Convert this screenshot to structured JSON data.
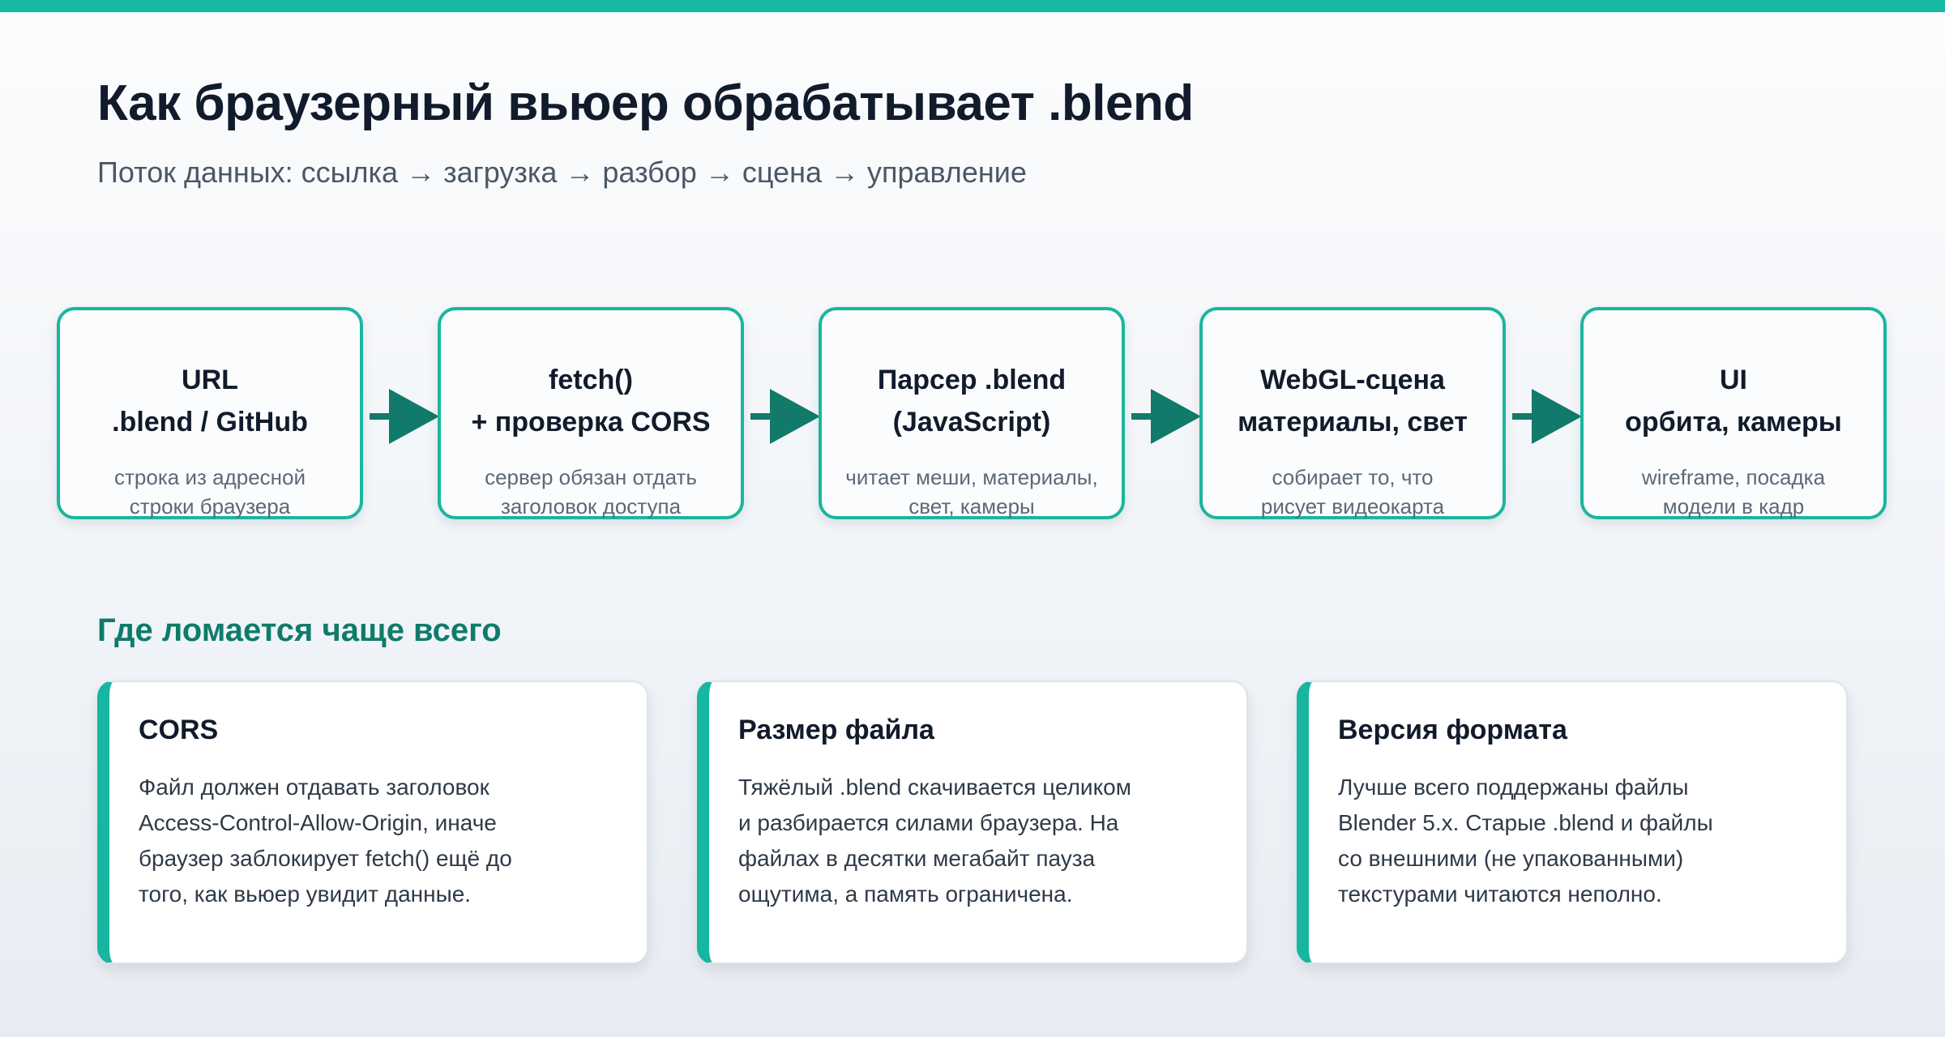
{
  "header": {
    "title": "Как браузерный вьюер обрабатывает .blend",
    "subtitle": "Поток данных: ссылка → загрузка → разбор → сцена → управление"
  },
  "stages": [
    {
      "title": [
        "URL",
        ".blend / GitHub"
      ],
      "desc": [
        "строка из адресной",
        "строки браузера"
      ]
    },
    {
      "title": [
        "fetch()",
        "+ проверка CORS"
      ],
      "desc": [
        "сервер обязан отдать",
        "заголовок доступа"
      ]
    },
    {
      "title": [
        "Парсер .blend",
        "(JavaScript)"
      ],
      "desc": [
        "читает меши, материалы,",
        "свет, камеры"
      ]
    },
    {
      "title": [
        "WebGL-сцена",
        "материалы, свет"
      ],
      "desc": [
        "собирает то, что",
        "рисует видеокарта"
      ]
    },
    {
      "title": [
        "UI",
        "орбита, камеры"
      ],
      "desc": [
        "wireframe, посадка",
        "модели в кадр"
      ]
    }
  ],
  "issues": {
    "title": "Где ломается чаще всего",
    "cards": [
      {
        "title": "CORS",
        "body": [
          "Файл должен отдавать заголовок",
          "Access-Control-Allow-Origin, иначе",
          "браузер заблокирует fetch() ещё до",
          "того, как вьюер увидит данные."
        ]
      },
      {
        "title": "Размер файла",
        "body": [
          "Тяжёлый .blend скачивается целиком",
          "и разбирается силами браузера. На",
          "файлах в десятки мегабайт пауза",
          "ощутима, а память ограничена."
        ]
      },
      {
        "title": "Версия формата",
        "body": [
          "Лучше всего поддержаны файлы",
          "Blender 5.x. Старые .blend и файлы",
          "со внешними (не упакованными)",
          "текстурами читаются неполно."
        ]
      }
    ]
  },
  "colors": {
    "accent": "#17b9a3",
    "arrow": "#117a6a",
    "section": "#0e7b6b",
    "text": "#111b2b"
  }
}
